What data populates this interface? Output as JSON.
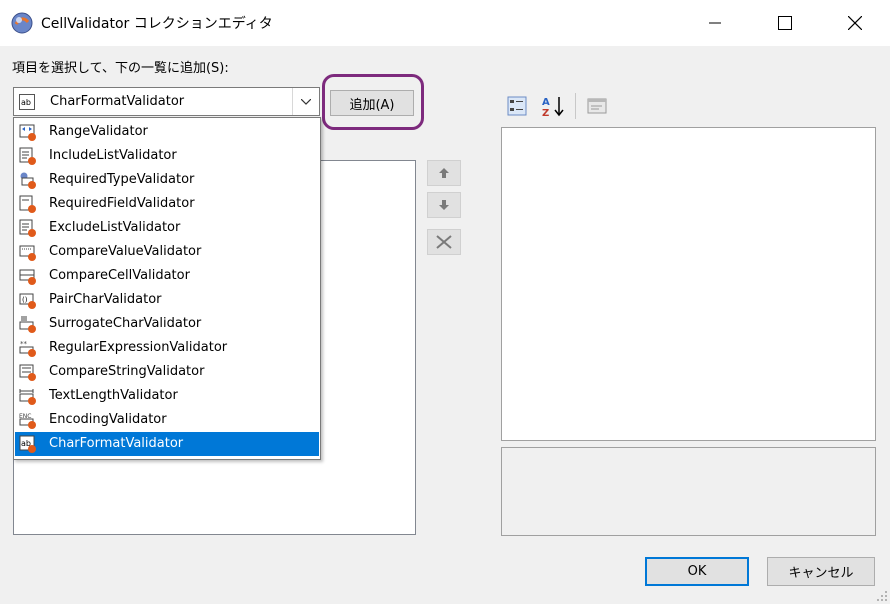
{
  "window": {
    "title": "CellValidator コレクションエディタ",
    "minimize_icon": "minimize-icon",
    "maximize_icon": "maximize-icon",
    "close_icon": "close-icon"
  },
  "selector": {
    "label": "項目を選択して、下の一覧に追加(S):",
    "selected_value": "CharFormatValidator",
    "add_button": "追加(A)",
    "options": [
      {
        "label": "RangeValidator",
        "icon": "range-validator-icon"
      },
      {
        "label": "IncludeListValidator",
        "icon": "include-list-validator-icon"
      },
      {
        "label": "RequiredTypeValidator",
        "icon": "required-type-validator-icon"
      },
      {
        "label": "RequiredFieldValidator",
        "icon": "required-field-validator-icon"
      },
      {
        "label": "ExcludeListValidator",
        "icon": "exclude-list-validator-icon"
      },
      {
        "label": "CompareValueValidator",
        "icon": "compare-value-validator-icon"
      },
      {
        "label": "CompareCellValidator",
        "icon": "compare-cell-validator-icon"
      },
      {
        "label": "PairCharValidator",
        "icon": "pair-char-validator-icon"
      },
      {
        "label": "SurrogateCharValidator",
        "icon": "surrogate-char-validator-icon"
      },
      {
        "label": "RegularExpressionValidator",
        "icon": "regular-expression-validator-icon"
      },
      {
        "label": "CompareStringValidator",
        "icon": "compare-string-validator-icon"
      },
      {
        "label": "TextLengthValidator",
        "icon": "text-length-validator-icon"
      },
      {
        "label": "EncodingValidator",
        "icon": "encoding-validator-icon"
      },
      {
        "label": "CharFormatValidator",
        "icon": "char-format-validator-icon",
        "selected": true
      }
    ]
  },
  "member_list": {
    "items": []
  },
  "move_buttons": {
    "up_icon": "arrow-up-icon",
    "down_icon": "arrow-down-icon",
    "remove_icon": "remove-x-icon"
  },
  "property_grid": {
    "categorized_icon": "categorized-icon",
    "alphabetical_icon": "sort-az-icon",
    "property_pages_icon": "property-pages-icon"
  },
  "footer": {
    "ok": "OK",
    "cancel": "キャンセル"
  },
  "colors": {
    "selection": "#0078d7",
    "highlight_ring": "#7d2a7d",
    "validator_badge": "#e05a1a"
  }
}
